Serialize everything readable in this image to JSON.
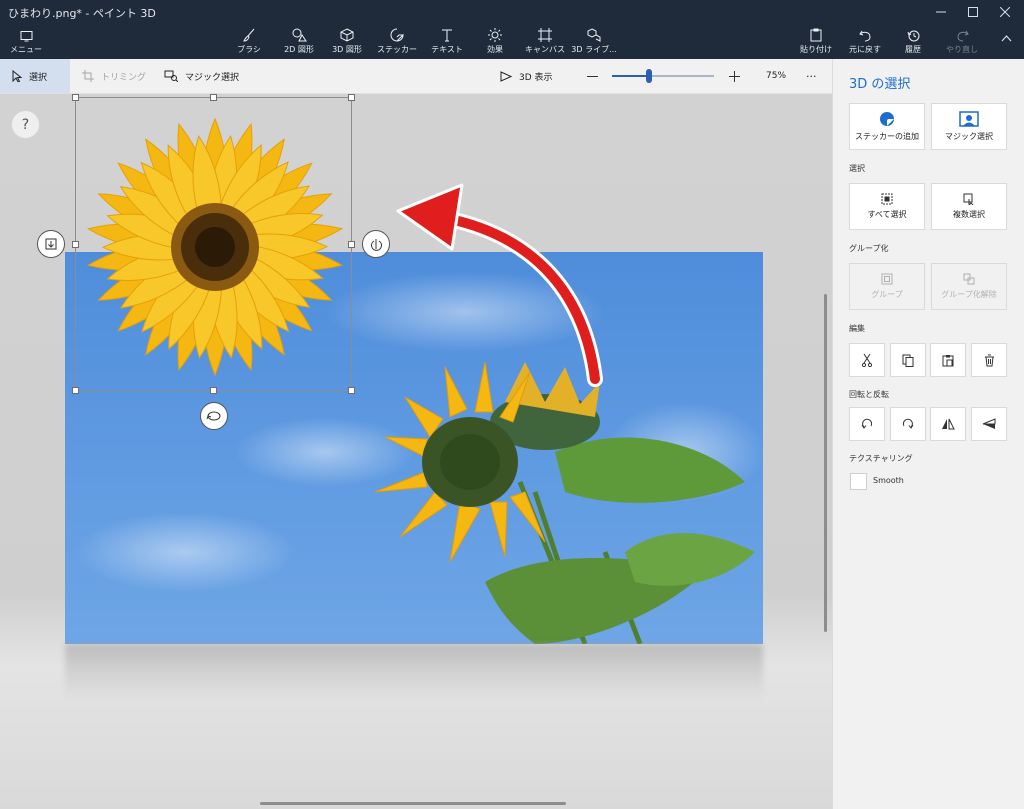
{
  "window": {
    "title": "ひまわり.png* - ペイント 3D"
  },
  "ribbon": {
    "menu_label": "メニュー",
    "tools": [
      {
        "label": "ブラシ",
        "icon": "brush-icon"
      },
      {
        "label": "2D 図形",
        "icon": "2d-shapes-icon"
      },
      {
        "label": "3D 図形",
        "icon": "3d-shapes-icon"
      },
      {
        "label": "ステッカー",
        "icon": "sticker-icon"
      },
      {
        "label": "テキスト",
        "icon": "text-icon"
      },
      {
        "label": "効果",
        "icon": "effects-icon"
      },
      {
        "label": "キャンバス",
        "icon": "canvas-icon"
      },
      {
        "label": "3D ライブ...",
        "icon": "3d-library-icon"
      }
    ],
    "paste_label": "貼り付け",
    "undo_label": "元に戻す",
    "history_label": "履歴",
    "redo_label": "やり直し"
  },
  "toolbar": {
    "select_label": "選択",
    "crop_label": "トリミング",
    "magic_select_label": "マジック選択",
    "view3d_label": "3D 表示",
    "zoom_percent": "75%",
    "zoom_level": 0.36,
    "more_label": "···"
  },
  "canvas": {
    "help_label": "?"
  },
  "panel": {
    "title": "3D の選択",
    "add_sticker_label": "ステッカーの追加",
    "magic_select_label": "マジック選択",
    "select_section": "選択",
    "select_all_label": "すべて選択",
    "multi_select_label": "複数選択",
    "group_section": "グループ化",
    "group_label": "グループ",
    "ungroup_label": "グループ化解除",
    "edit_section": "編集",
    "rotate_section": "回転と反転",
    "texture_section": "テクスチャリング",
    "smooth_label": "Smooth"
  },
  "colors": {
    "chrome": "#1f2b3a",
    "accent": "#1c6dd0",
    "arrow": "#e01e1e",
    "sky": "#5a98df",
    "petal": "#f5b812"
  }
}
